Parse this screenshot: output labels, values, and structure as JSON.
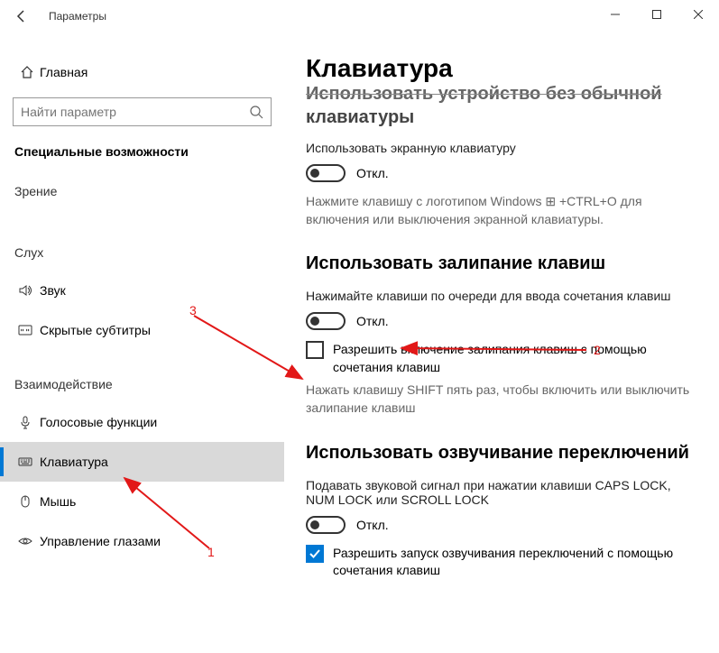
{
  "window": {
    "title": "Параметры"
  },
  "sidebar": {
    "home": "Главная",
    "search_placeholder": "Найти параметр",
    "category": "Специальные возможности",
    "groups": {
      "vision": "Зрение",
      "hearing": "Слух",
      "interaction": "Взаимодействие"
    },
    "items": {
      "sound": "Звук",
      "captions": "Скрытые субтитры",
      "speech": "Голосовые функции",
      "keyboard": "Клавиатура",
      "mouse": "Мышь",
      "eye": "Управление глазами"
    }
  },
  "content": {
    "title": "Клавиатура",
    "cut_top": "Использовать устройство без обычной",
    "cut_bottom": "клавиатуры",
    "osk_label": "Использовать экранную клавиатуру",
    "off": "Откл.",
    "osk_help": "Нажмите клавишу с логотипом Windows ⊞ +CTRL+O для включения или выключения экранной клавиатуры.",
    "sticky_h": "Использовать залипание клавиш",
    "sticky_label": "Нажимайте клавиши по очереди для ввода сочетания клавиш",
    "sticky_chk": "Разрешить включение залипания клавиш с помощью сочетания клавиш",
    "sticky_help": "Нажать клавишу SHIFT пять раз, чтобы включить или выключить залипание клавиш",
    "toggle_h": "Использовать озвучивание переключений",
    "toggle_label": "Подавать звуковой сигнал при нажатии клавиши CAPS LOCK, NUM LOCK или SCROLL LOCK",
    "toggle_chk": "Разрешить запуск озвучивания переключений с помощью сочетания клавиш"
  },
  "annotations": {
    "n1": "1",
    "n2": "2",
    "n3": "3"
  }
}
